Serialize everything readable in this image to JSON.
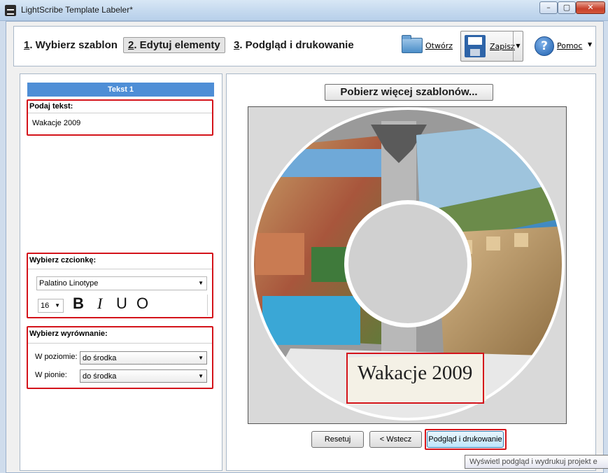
{
  "window": {
    "title": "LightScribe Template Labeler*",
    "controls": {
      "minimize": "–",
      "maximize": "▢",
      "close": "✕"
    }
  },
  "steps": [
    {
      "num": "1",
      "label": ". Wybierz szablon"
    },
    {
      "num": "2",
      "label": ". Edytuj elementy"
    },
    {
      "num": "3",
      "label": ". Podgląd i drukowanie"
    }
  ],
  "toolbar": {
    "open_label": "Otwórz",
    "save_label": "Zapisz",
    "help_label": "Pomoc",
    "dropdown_glyph": "▼",
    "help_glyph": "?"
  },
  "left_panel": {
    "tab_title": "Tekst 1",
    "text_section": {
      "title": "Podaj tekst:",
      "value": "Wakacje 2009"
    },
    "font_section": {
      "title": "Wybierz czcionkę:",
      "font": "Palatino Linotype",
      "size": "16",
      "bold": "B",
      "italic": "I",
      "underline": "U",
      "outline": "O"
    },
    "align_section": {
      "title": "Wybierz wyrównanie:",
      "horizontal_label": "W poziomie:",
      "horizontal_value": "do środka",
      "vertical_label": "W pionie:",
      "vertical_value": "do środka"
    }
  },
  "right_panel": {
    "more_templates_label": "Pobierz więcej szablonów...",
    "disc_label_text": "Wakacje 2009",
    "buttons": {
      "reset": "Resetuj",
      "back": "< Wstecz",
      "print": "Podgląd i drukowanie"
    }
  },
  "tooltip": "Wyświetl podgląd i wydrukuj projekt e",
  "colors": {
    "highlight": "#d4141b",
    "tab_header": "#4e8ed6",
    "accent": "#3c7fb1"
  }
}
